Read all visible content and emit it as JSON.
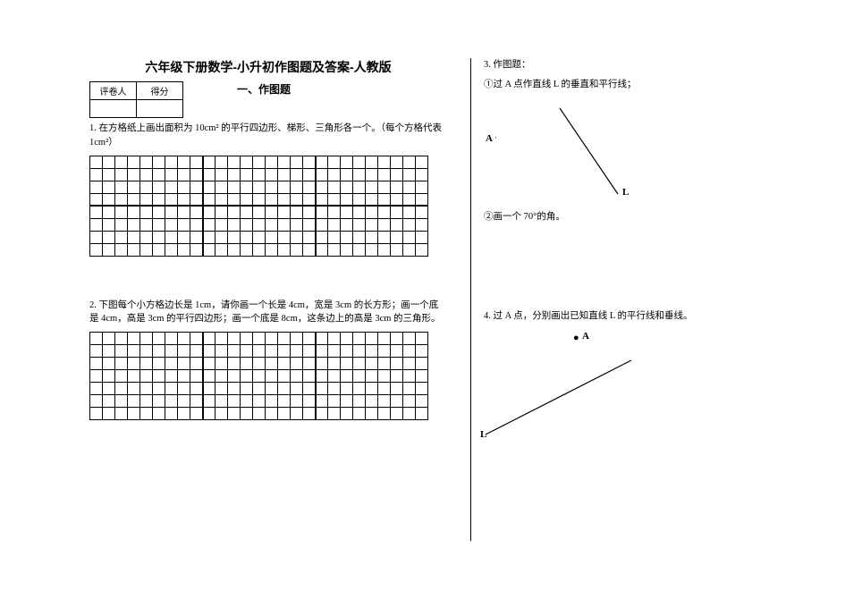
{
  "title": "六年级下册数学-小升初作图题及答案-人教版",
  "score": {
    "h1": "评卷人",
    "h2": "得分"
  },
  "section1": "一、作图题",
  "q1": {
    "text": "1. 在方格纸上画出面积为 10cm² 的平行四边形、梯形、三角形各一个。（每个方格代表 1cm²）"
  },
  "q2": {
    "text": "2. 下图每个小方格边长是 1cm，请你画一个长是 4cm，宽是 3cm 的长方形；画一个底是 4cm，高是 3cm 的平行四边形；画一个底是 8cm，这条边上的高是 3cm 的三角形。"
  },
  "q3": {
    "title": "3. 作图题：",
    "sub1": "①过 A 点作直线 L 的垂直和平行线；",
    "labelA": "A",
    "labelL": "L",
    "sub2": "②画一个 70°的角。"
  },
  "q4": {
    "text": "4. 过 A 点，分别画出已知直线 L 的平行线和垂线。",
    "labelA": "A",
    "labelL": "L"
  }
}
